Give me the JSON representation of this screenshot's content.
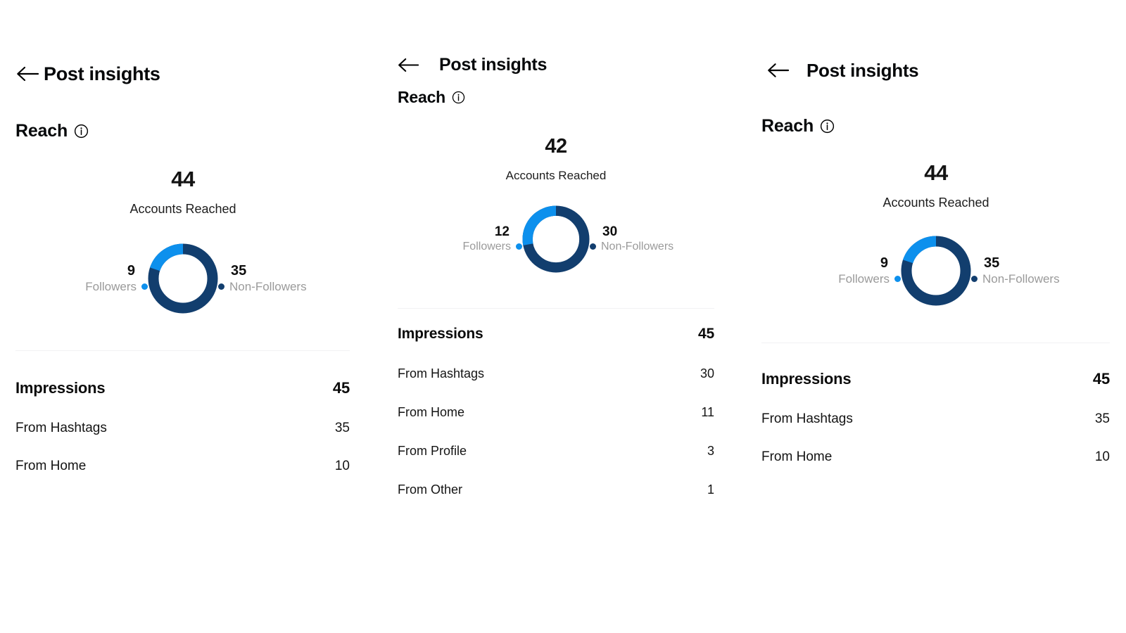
{
  "colors": {
    "followers": "#0d90ed",
    "non_followers": "#123e6e",
    "divider": "#f2f2f3",
    "muted_text": "#9a9a9a"
  },
  "panels": [
    {
      "title": "Post insights",
      "back_icon": "arrow-left-icon",
      "reach": {
        "label": "Reach",
        "info_icon": "info-circle-icon",
        "total": "44",
        "caption": "Accounts Reached",
        "followers_value": "9",
        "followers_label": "Followers",
        "non_followers_value": "35",
        "non_followers_label": "Non-Followers"
      },
      "impressions": {
        "label": "Impressions",
        "total": "45",
        "rows": [
          {
            "label": "From Hashtags",
            "value": "35"
          },
          {
            "label": "From Home",
            "value": "10"
          }
        ]
      },
      "chart_data": {
        "type": "pie",
        "title": "Reach",
        "subtitle": "Accounts Reached",
        "labels": [
          "Followers",
          "Non-Followers"
        ],
        "values": [
          9,
          35
        ],
        "total": 44,
        "colors": [
          "#0d90ed",
          "#123e6e"
        ],
        "donut": true,
        "legend_position": "sides"
      }
    },
    {
      "title": "Post insights",
      "back_icon": "arrow-left-icon",
      "reach": {
        "label": "Reach",
        "info_icon": "info-circle-icon",
        "total": "42",
        "caption": "Accounts Reached",
        "followers_value": "12",
        "followers_label": "Followers",
        "non_followers_value": "30",
        "non_followers_label": "Non-Followers"
      },
      "impressions": {
        "label": "Impressions",
        "total": "45",
        "rows": [
          {
            "label": "From Hashtags",
            "value": "30"
          },
          {
            "label": "From Home",
            "value": "11"
          },
          {
            "label": "From Profile",
            "value": "3"
          },
          {
            "label": "From Other",
            "value": "1"
          }
        ]
      },
      "chart_data": {
        "type": "pie",
        "title": "Reach",
        "subtitle": "Accounts Reached",
        "labels": [
          "Followers",
          "Non-Followers"
        ],
        "values": [
          12,
          30
        ],
        "total": 42,
        "colors": [
          "#0d90ed",
          "#123e6e"
        ],
        "donut": true,
        "legend_position": "sides"
      }
    },
    {
      "title": "Post insights",
      "back_icon": "arrow-left-icon",
      "reach": {
        "label": "Reach",
        "info_icon": "info-circle-icon",
        "total": "44",
        "caption": "Accounts Reached",
        "followers_value": "9",
        "followers_label": "Followers",
        "non_followers_value": "35",
        "non_followers_label": "Non-Followers"
      },
      "impressions": {
        "label": "Impressions",
        "total": "45",
        "rows": [
          {
            "label": "From Hashtags",
            "value": "35"
          },
          {
            "label": "From Home",
            "value": "10"
          }
        ]
      },
      "chart_data": {
        "type": "pie",
        "title": "Reach",
        "subtitle": "Accounts Reached",
        "labels": [
          "Followers",
          "Non-Followers"
        ],
        "values": [
          9,
          35
        ],
        "total": 44,
        "colors": [
          "#0d90ed",
          "#123e6e"
        ],
        "donut": true,
        "legend_position": "sides"
      }
    }
  ],
  "chart_data": [
    {
      "type": "pie",
      "title": "Reach — 44 Accounts Reached",
      "labels": [
        "Followers",
        "Non-Followers"
      ],
      "values": [
        9,
        35
      ],
      "total": 44,
      "colors": [
        "#0d90ed",
        "#123e6e"
      ],
      "donut": true
    },
    {
      "type": "pie",
      "title": "Reach — 42 Accounts Reached",
      "labels": [
        "Followers",
        "Non-Followers"
      ],
      "values": [
        12,
        30
      ],
      "total": 42,
      "colors": [
        "#0d90ed",
        "#123e6e"
      ],
      "donut": true
    },
    {
      "type": "pie",
      "title": "Reach — 44 Accounts Reached",
      "labels": [
        "Followers",
        "Non-Followers"
      ],
      "values": [
        9,
        35
      ],
      "total": 44,
      "colors": [
        "#0d90ed",
        "#123e6e"
      ],
      "donut": true
    }
  ]
}
